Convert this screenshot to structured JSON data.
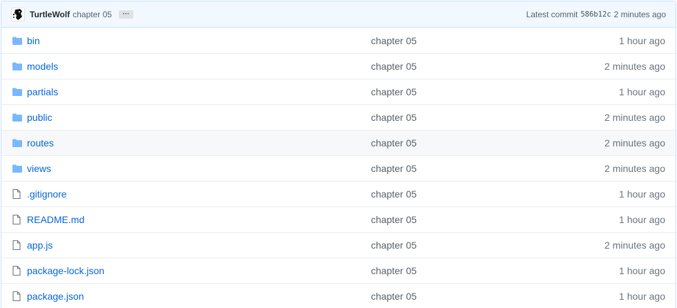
{
  "commit": {
    "author": "TurtleWolf",
    "message": "chapter 05",
    "ellipsis": "···",
    "prefix": "Latest commit",
    "sha": "586b12c",
    "time": "2 minutes ago"
  },
  "files": [
    {
      "name": "bin",
      "type": "folder",
      "message": "chapter 05",
      "age": "1 hour ago"
    },
    {
      "name": "models",
      "type": "folder",
      "message": "chapter 05",
      "age": "2 minutes ago"
    },
    {
      "name": "partials",
      "type": "folder",
      "message": "chapter 05",
      "age": "1 hour ago"
    },
    {
      "name": "public",
      "type": "folder",
      "message": "chapter 05",
      "age": "2 minutes ago"
    },
    {
      "name": "routes",
      "type": "folder",
      "message": "chapter 05",
      "age": "2 minutes ago"
    },
    {
      "name": "views",
      "type": "folder",
      "message": "chapter 05",
      "age": "2 minutes ago"
    },
    {
      "name": ".gitignore",
      "type": "file",
      "message": "chapter 05",
      "age": "1 hour ago"
    },
    {
      "name": "README.md",
      "type": "file",
      "message": "chapter 05",
      "age": "1 hour ago"
    },
    {
      "name": "app.js",
      "type": "file",
      "message": "chapter 05",
      "age": "2 minutes ago"
    },
    {
      "name": "package-lock.json",
      "type": "file",
      "message": "chapter 05",
      "age": "1 hour ago"
    },
    {
      "name": "package.json",
      "type": "file",
      "message": "chapter 05",
      "age": "1 hour ago"
    }
  ],
  "colors": {
    "link": "#0366d6",
    "folder_icon": "#79b8ff",
    "file_icon": "#6a737d",
    "header_bg": "#f1f8ff"
  }
}
